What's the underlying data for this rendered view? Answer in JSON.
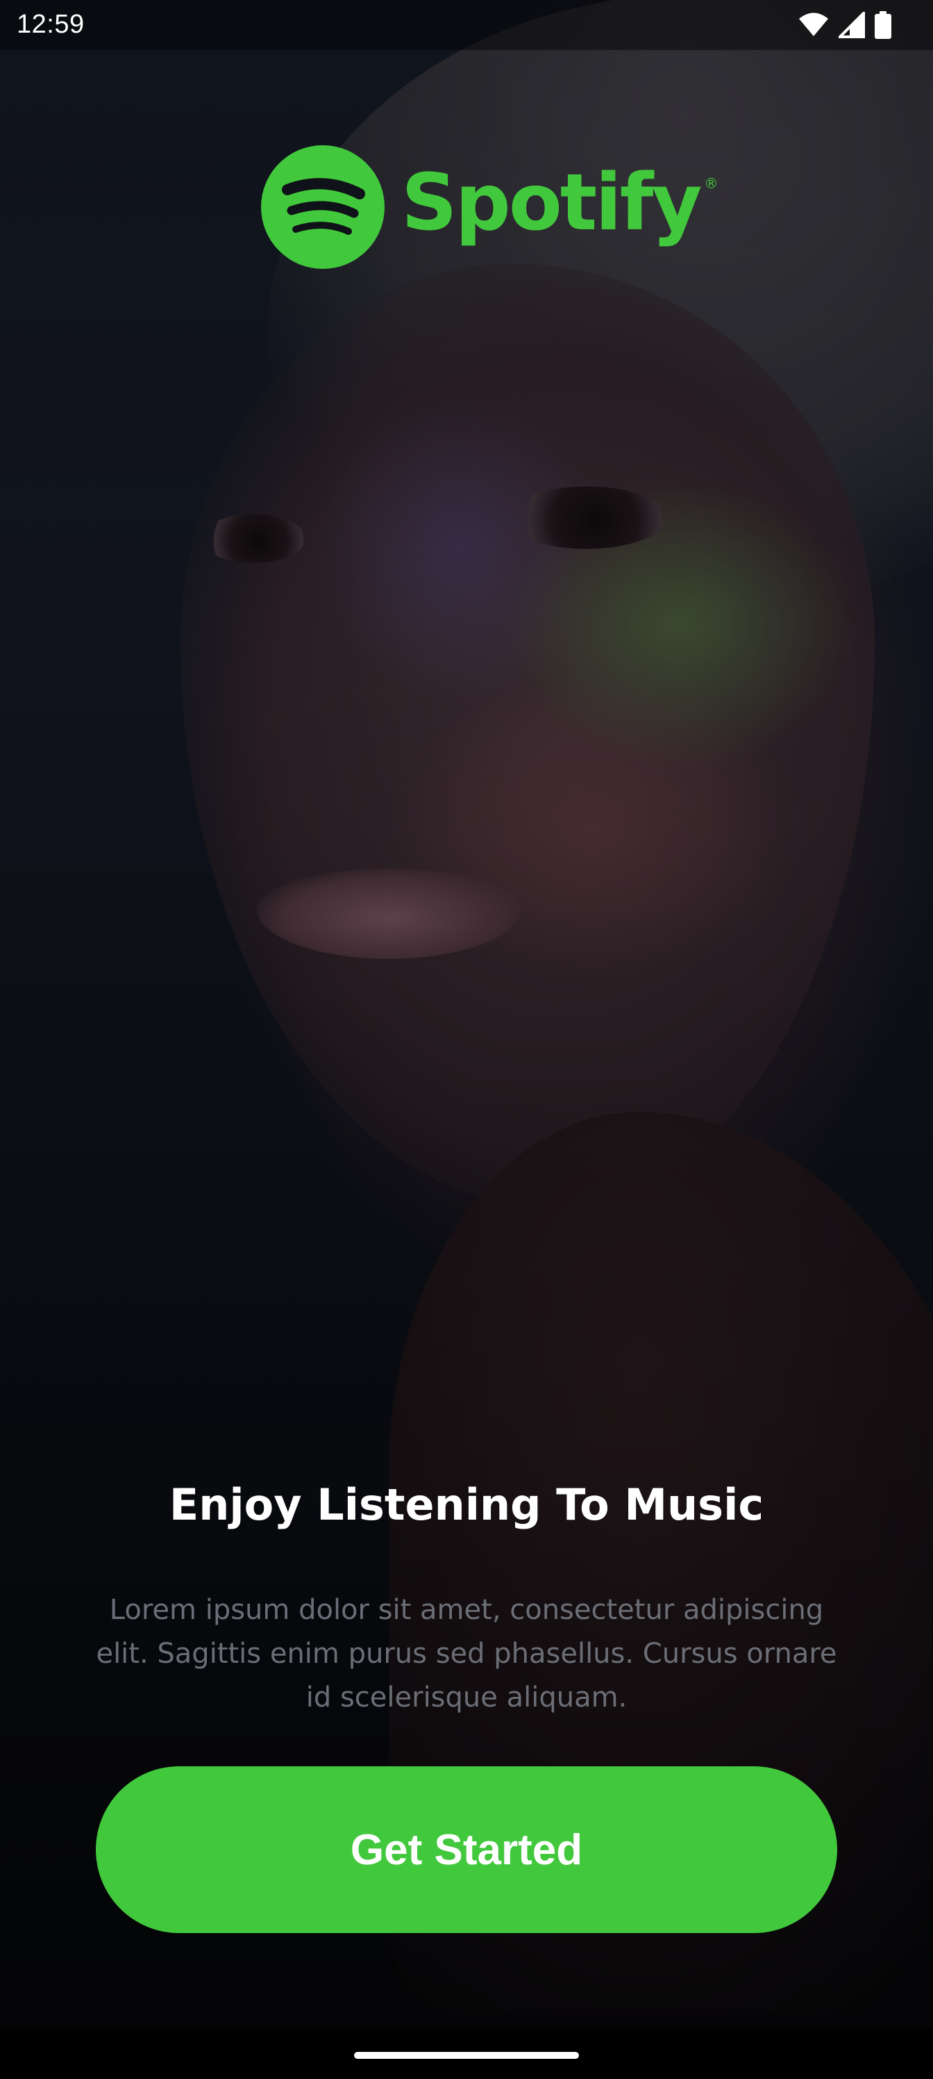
{
  "status_bar": {
    "time": "12:59"
  },
  "logo": {
    "text": "Spotify",
    "registered_mark": "®",
    "icon": "spotify-logo-icon",
    "color": "#42c83c"
  },
  "onboarding": {
    "headline": "Enjoy Listening To Music",
    "description": "Lorem ipsum dolor sit amet, consectetur adipiscing elit. Sagittis enim purus sed phasellus. Cursus ornare id scelerisque aliquam.",
    "cta_label": "Get Started"
  },
  "colors": {
    "accent": "#42c83c",
    "headline_text": "#ffffff",
    "description_text": "#6b6e76"
  }
}
